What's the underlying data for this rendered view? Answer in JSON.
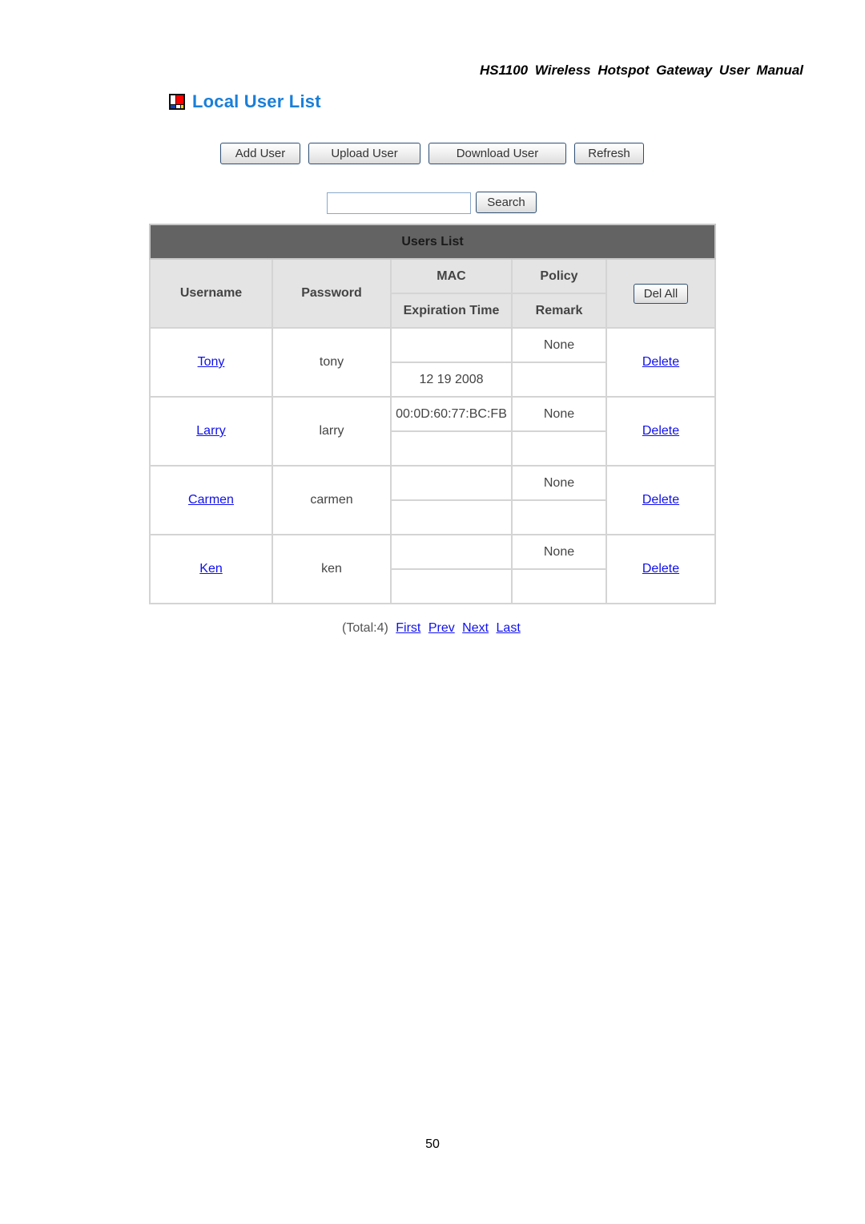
{
  "document": {
    "header": "HS1100  Wireless  Hotspot  Gateway  User  Manual",
    "page_number": "50"
  },
  "page": {
    "icon": "mondrian-square-icon",
    "title": "Local User List"
  },
  "toolbar": {
    "add_user": "Add User",
    "upload_user": "Upload User",
    "download_user": "Download User",
    "refresh": "Refresh"
  },
  "search": {
    "value": "",
    "placeholder": "",
    "button": "Search"
  },
  "table": {
    "caption": "Users List",
    "headers": {
      "username": "Username",
      "password": "Password",
      "mac": "MAC",
      "policy": "Policy",
      "expiration_time": "Expiration Time",
      "remark": "Remark",
      "del_all": "Del All"
    },
    "rows": [
      {
        "username": "Tony",
        "password": "tony",
        "mac": "",
        "policy": "None",
        "expiration_time": "12 19 2008",
        "remark": "",
        "action": "Delete"
      },
      {
        "username": "Larry",
        "password": "larry",
        "mac": "00:0D:60:77:BC:FB",
        "policy": "None",
        "expiration_time": "",
        "remark": "",
        "action": "Delete"
      },
      {
        "username": "Carmen",
        "password": "carmen",
        "mac": "",
        "policy": "None",
        "expiration_time": "",
        "remark": "",
        "action": "Delete"
      },
      {
        "username": "Ken",
        "password": "ken",
        "mac": "",
        "policy": "None",
        "expiration_time": "",
        "remark": "",
        "action": "Delete"
      }
    ]
  },
  "pager": {
    "total": "(Total:4)",
    "first": "First",
    "prev": "Prev",
    "next": "Next",
    "last": "Last"
  }
}
